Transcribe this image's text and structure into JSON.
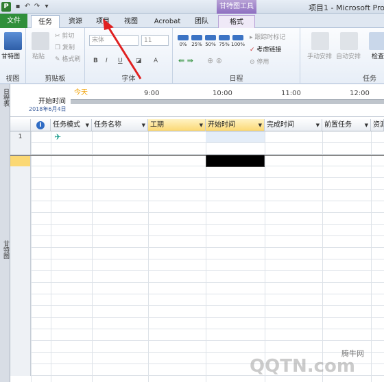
{
  "titlebar": {
    "app_icon_letter": "P",
    "contextual_title": "甘特图工具",
    "window_title": "项目1 - Microsoft Proj"
  },
  "tabs": {
    "file": "文件",
    "task": "任务",
    "resource": "资源",
    "project": "项目",
    "view": "视图",
    "acrobat": "Acrobat",
    "team": "团队",
    "format": "格式"
  },
  "ribbon": {
    "view_group": {
      "gantt_label": "甘特图",
      "label": "视图"
    },
    "clipboard": {
      "paste": "粘贴",
      "cut": "剪切",
      "copy": "复制",
      "format_painter": "格式刷",
      "label": "剪贴板"
    },
    "font": {
      "font_name": "宋体",
      "font_size": "11",
      "bold": "B",
      "italic": "I",
      "underline": "U",
      "label": "字体"
    },
    "schedule": {
      "pct": [
        "0%",
        "25%",
        "50%",
        "75%",
        "100%"
      ],
      "mark_on_track": "跟踪时标记",
      "respect_links": "考虑链接",
      "inactivate": "停用",
      "label": "日程"
    },
    "tasks": {
      "manual": "手动安排",
      "auto": "自动安排",
      "inspect": "检查",
      "label": "任务"
    }
  },
  "timeline": {
    "side_label": "日程表",
    "today": "今天",
    "start_label": "开始时间",
    "start_date": "2018年6月4日",
    "ticks": [
      "9:00",
      "10:00",
      "11:00",
      "12:00"
    ]
  },
  "gantt": {
    "side_label": "甘特图",
    "columns": [
      "",
      "任务模式",
      "任务名称",
      "工期",
      "开始时间",
      "完成时间",
      "前置任务",
      "资源"
    ],
    "rows": [
      {
        "id": "1",
        "mode_icon": "task-mode-icon"
      }
    ]
  },
  "watermark": {
    "site": "腾牛网",
    "logo": "QQTN.com"
  },
  "colors": {
    "file_tab": "#2f8f3a",
    "contextual": "#8e6fc0",
    "selected_header": "#fbd874",
    "annotation_arrow": "#e02020"
  }
}
